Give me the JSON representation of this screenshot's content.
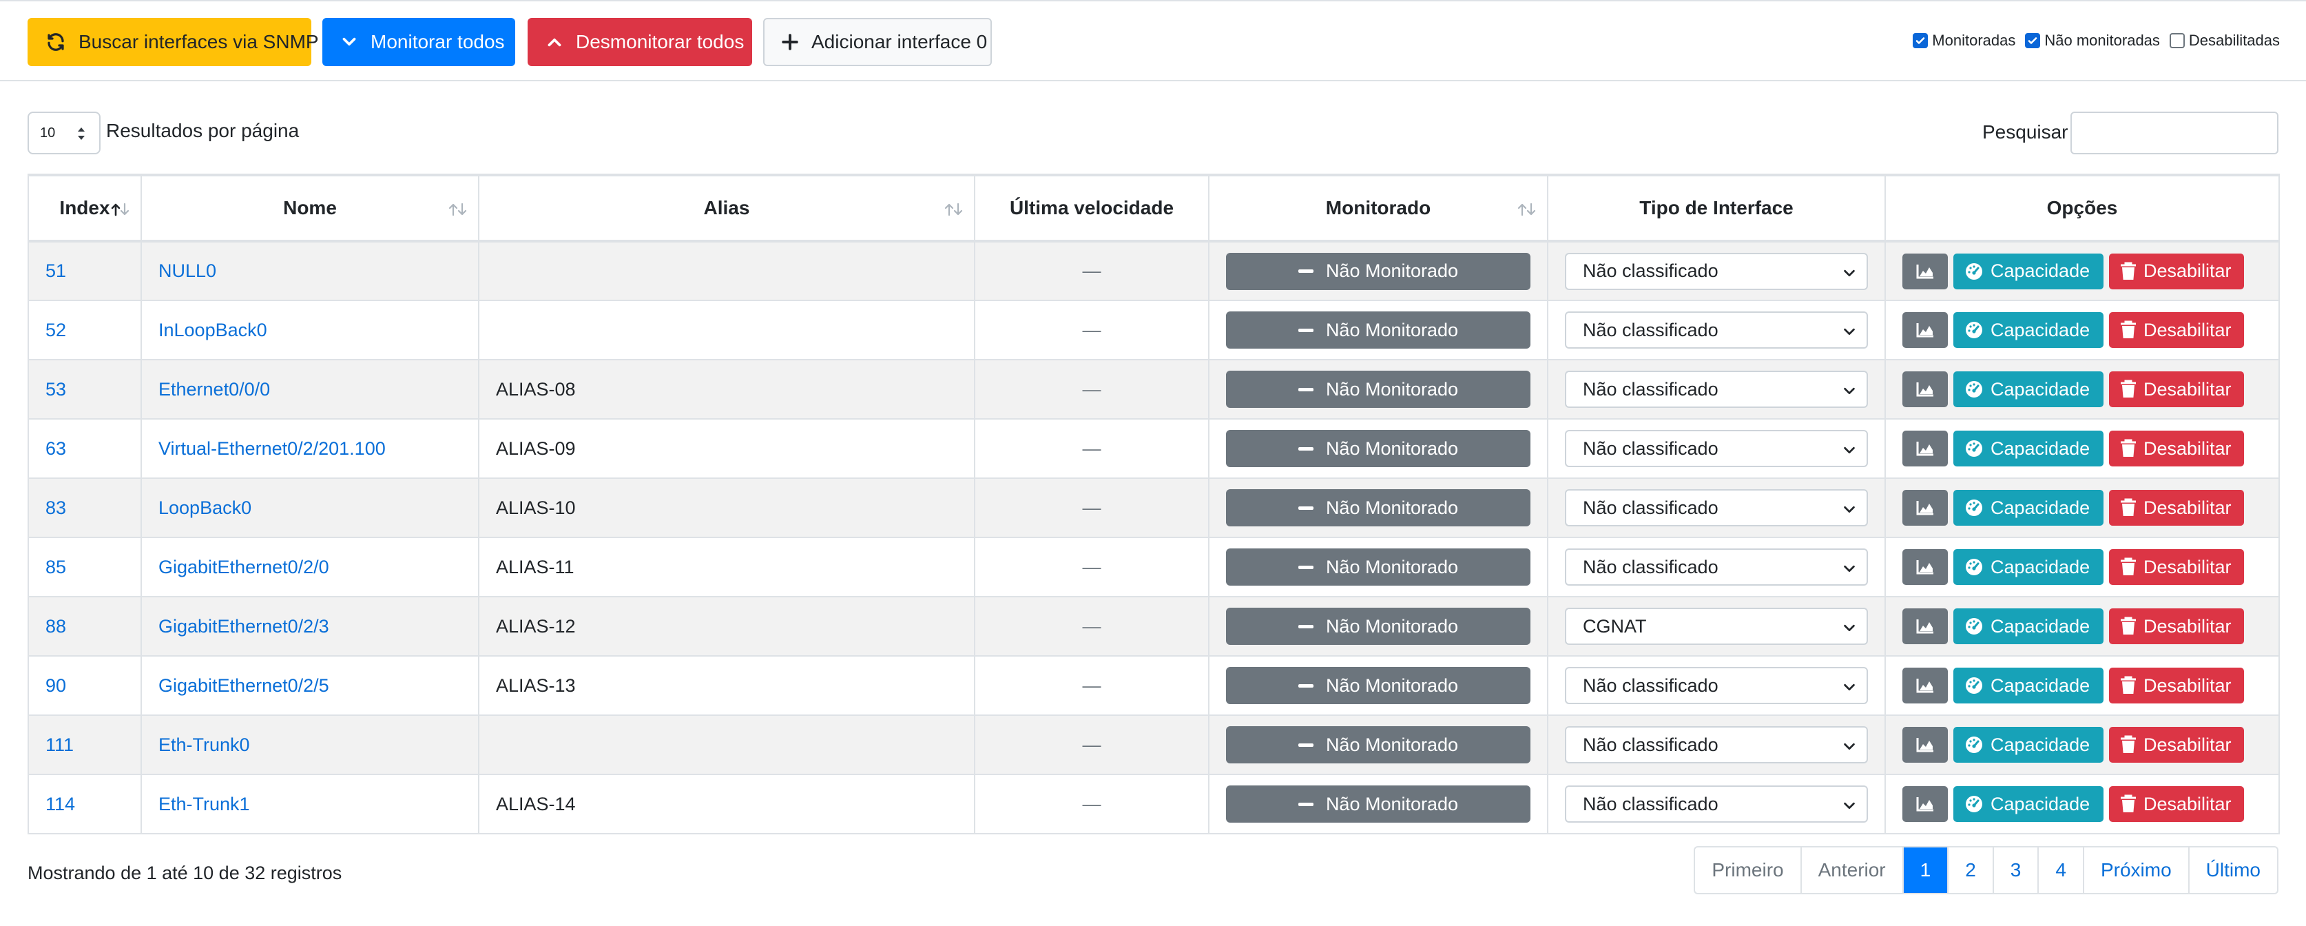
{
  "toolbar": {
    "fetch_snmp": "Buscar interfaces via SNMP",
    "monitor_all": "Monitorar todos",
    "unmonitor_all": "Desmonitorar todos",
    "add_interface": "Adicionar interface 0"
  },
  "filters": [
    {
      "label": "Monitoradas",
      "checked": true
    },
    {
      "label": "Não monitoradas",
      "checked": true
    },
    {
      "label": "Desabilitadas",
      "checked": false
    }
  ],
  "length": {
    "value": "10",
    "label": "Resultados por página"
  },
  "search": {
    "label": "Pesquisar",
    "value": ""
  },
  "columns": [
    "Index",
    "Nome",
    "Alias",
    "Última velocidade",
    "Monitorado",
    "Tipo de Interface",
    "Opções"
  ],
  "rows": [
    {
      "index": "51",
      "name": "NULL0",
      "alias": "",
      "speed": "—",
      "status": "Não Monitorado",
      "type": "Não classificado"
    },
    {
      "index": "52",
      "name": "InLoopBack0",
      "alias": "",
      "speed": "—",
      "status": "Não Monitorado",
      "type": "Não classificado"
    },
    {
      "index": "53",
      "name": "Ethernet0/0/0",
      "alias": "ALIAS-08",
      "speed": "—",
      "status": "Não Monitorado",
      "type": "Não classificado"
    },
    {
      "index": "63",
      "name": "Virtual-Ethernet0/2/201.100",
      "alias": "ALIAS-09",
      "speed": "—",
      "status": "Não Monitorado",
      "type": "Não classificado"
    },
    {
      "index": "83",
      "name": "LoopBack0",
      "alias": "ALIAS-10",
      "speed": "—",
      "status": "Não Monitorado",
      "type": "Não classificado"
    },
    {
      "index": "85",
      "name": "GigabitEthernet0/2/0",
      "alias": "ALIAS-11",
      "speed": "—",
      "status": "Não Monitorado",
      "type": "Não classificado"
    },
    {
      "index": "88",
      "name": "GigabitEthernet0/2/3",
      "alias": "ALIAS-12",
      "speed": "—",
      "status": "Não Monitorado",
      "type": "CGNAT"
    },
    {
      "index": "90",
      "name": "GigabitEthernet0/2/5",
      "alias": "ALIAS-13",
      "speed": "—",
      "status": "Não Monitorado",
      "type": "Não classificado"
    },
    {
      "index": "111",
      "name": "Eth-Trunk0",
      "alias": "",
      "speed": "—",
      "status": "Não Monitorado",
      "type": "Não classificado"
    },
    {
      "index": "114",
      "name": "Eth-Trunk1",
      "alias": "ALIAS-14",
      "speed": "—",
      "status": "Não Monitorado",
      "type": "Não classificado"
    }
  ],
  "row_actions": {
    "capacity": "Capacidade",
    "disable": "Desabilitar"
  },
  "info": "Mostrando de 1 até 10 de 32 registros",
  "pagination": [
    {
      "label": "Primeiro",
      "state": "disabled"
    },
    {
      "label": "Anterior",
      "state": "disabled"
    },
    {
      "label": "1",
      "state": "active"
    },
    {
      "label": "2",
      "state": "normal"
    },
    {
      "label": "3",
      "state": "normal"
    },
    {
      "label": "4",
      "state": "normal"
    },
    {
      "label": "Próximo",
      "state": "normal"
    },
    {
      "label": "Último",
      "state": "normal"
    }
  ],
  "colors": {
    "warning": "#ffc107",
    "primary": "#007bff",
    "danger": "#dc3545",
    "secondary": "#6c757d",
    "info": "#17a2b8",
    "link": "#0a6fd8"
  }
}
